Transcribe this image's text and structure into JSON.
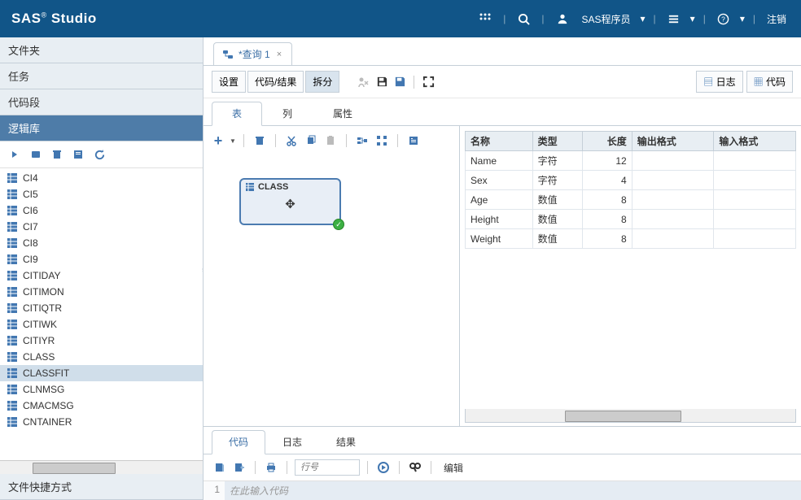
{
  "header": {
    "logo_main": "SAS",
    "logo_sub": "Studio",
    "user_label": "SAS程序员",
    "signout": "注销"
  },
  "left": {
    "sections": {
      "folders": "文件夹",
      "tasks": "任务",
      "snippets": "代码段",
      "libraries": "逻辑库",
      "shortcuts": "文件快捷方式"
    },
    "tree_items": [
      "CI4",
      "CI5",
      "CI6",
      "CI7",
      "CI8",
      "CI9",
      "CITIDAY",
      "CITIMON",
      "CITIQTR",
      "CITIWK",
      "CITIYR",
      "CLASS",
      "CLASSFIT",
      "CLNMSG",
      "CMACMSG",
      "CNTAINER"
    ],
    "selected": "CLASSFIT"
  },
  "editor": {
    "tab_label": "*查询 1",
    "buttons": {
      "settings": "设置",
      "code_results": "代码/结果",
      "split": "拆分"
    },
    "right_buttons": {
      "log": "日志",
      "code": "代码"
    },
    "sub_tabs": {
      "table": "表",
      "columns": "列",
      "properties": "属性"
    }
  },
  "table_node": {
    "name": "CLASS"
  },
  "columns_table": {
    "headers": {
      "name": "名称",
      "type": "类型",
      "length": "长度",
      "outformat": "输出格式",
      "informat": "输入格式"
    },
    "rows": [
      {
        "name": "Name",
        "type": "字符",
        "length": "12",
        "outformat": "",
        "informat": ""
      },
      {
        "name": "Sex",
        "type": "字符",
        "length": "4",
        "outformat": "",
        "informat": ""
      },
      {
        "name": "Age",
        "type": "数值",
        "length": "8",
        "outformat": "",
        "informat": ""
      },
      {
        "name": "Height",
        "type": "数值",
        "length": "8",
        "outformat": "",
        "informat": ""
      },
      {
        "name": "Weight",
        "type": "数值",
        "length": "8",
        "outformat": "",
        "informat": ""
      }
    ]
  },
  "bottom": {
    "tabs": {
      "code": "代码",
      "log": "日志",
      "results": "结果"
    },
    "lineno_placeholder": "行号",
    "edit_label": "编辑",
    "gutter_1": "1",
    "code_placeholder": "在此输入代码"
  }
}
